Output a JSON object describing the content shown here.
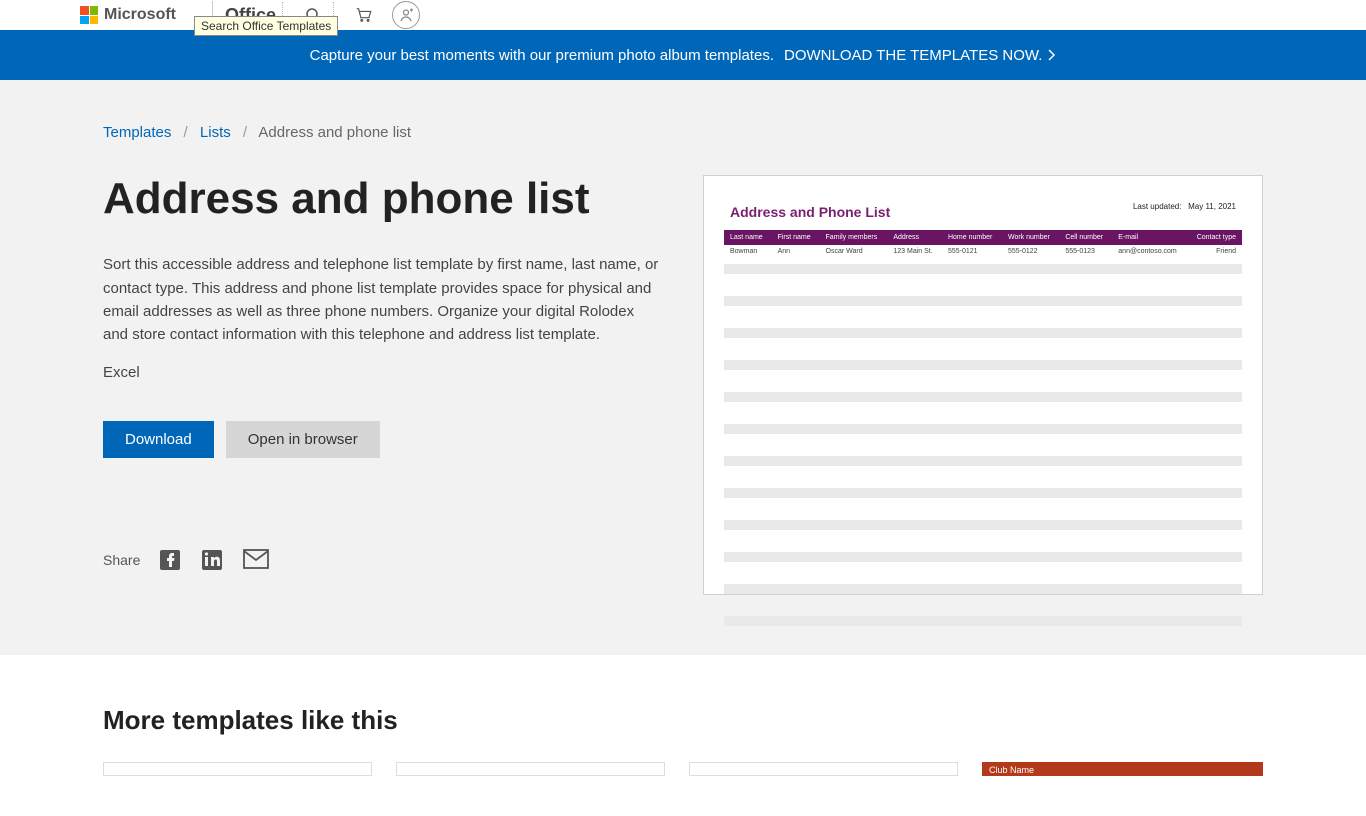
{
  "header": {
    "brand": "Microsoft",
    "product": "Office",
    "search_tooltip": "Search Office Templates"
  },
  "promo": {
    "text": "Capture your best moments with our premium photo album templates.",
    "cta": "DOWNLOAD THE TEMPLATES NOW."
  },
  "breadcrumb": {
    "root": "Templates",
    "parent": "Lists",
    "current": "Address and phone list"
  },
  "page": {
    "title": "Address and phone list",
    "description": "Sort this accessible address and telephone list template by first name, last name, or contact type. This address and phone list template provides space for physical and email addresses as well as three phone numbers. Organize your digital Rolodex and store contact information with this telephone and address list template.",
    "app": "Excel",
    "download": "Download",
    "open": "Open in browser",
    "share_label": "Share"
  },
  "preview": {
    "title": "Address and Phone List",
    "updated_label": "Last updated:",
    "updated_value": "May 11, 2021",
    "headers": [
      "Last name",
      "First name",
      "Family members",
      "Address",
      "Home number",
      "Work number",
      "Cell number",
      "E-mail",
      "Contact type"
    ],
    "row": [
      "Bowman",
      "Ann",
      "Oscar Ward",
      "123 Main St.",
      "555-0121",
      "555-0122",
      "555-0123",
      "ann@contoso.com",
      "Friend"
    ]
  },
  "more": {
    "heading": "More templates like this",
    "card4_label": "Club Name"
  }
}
